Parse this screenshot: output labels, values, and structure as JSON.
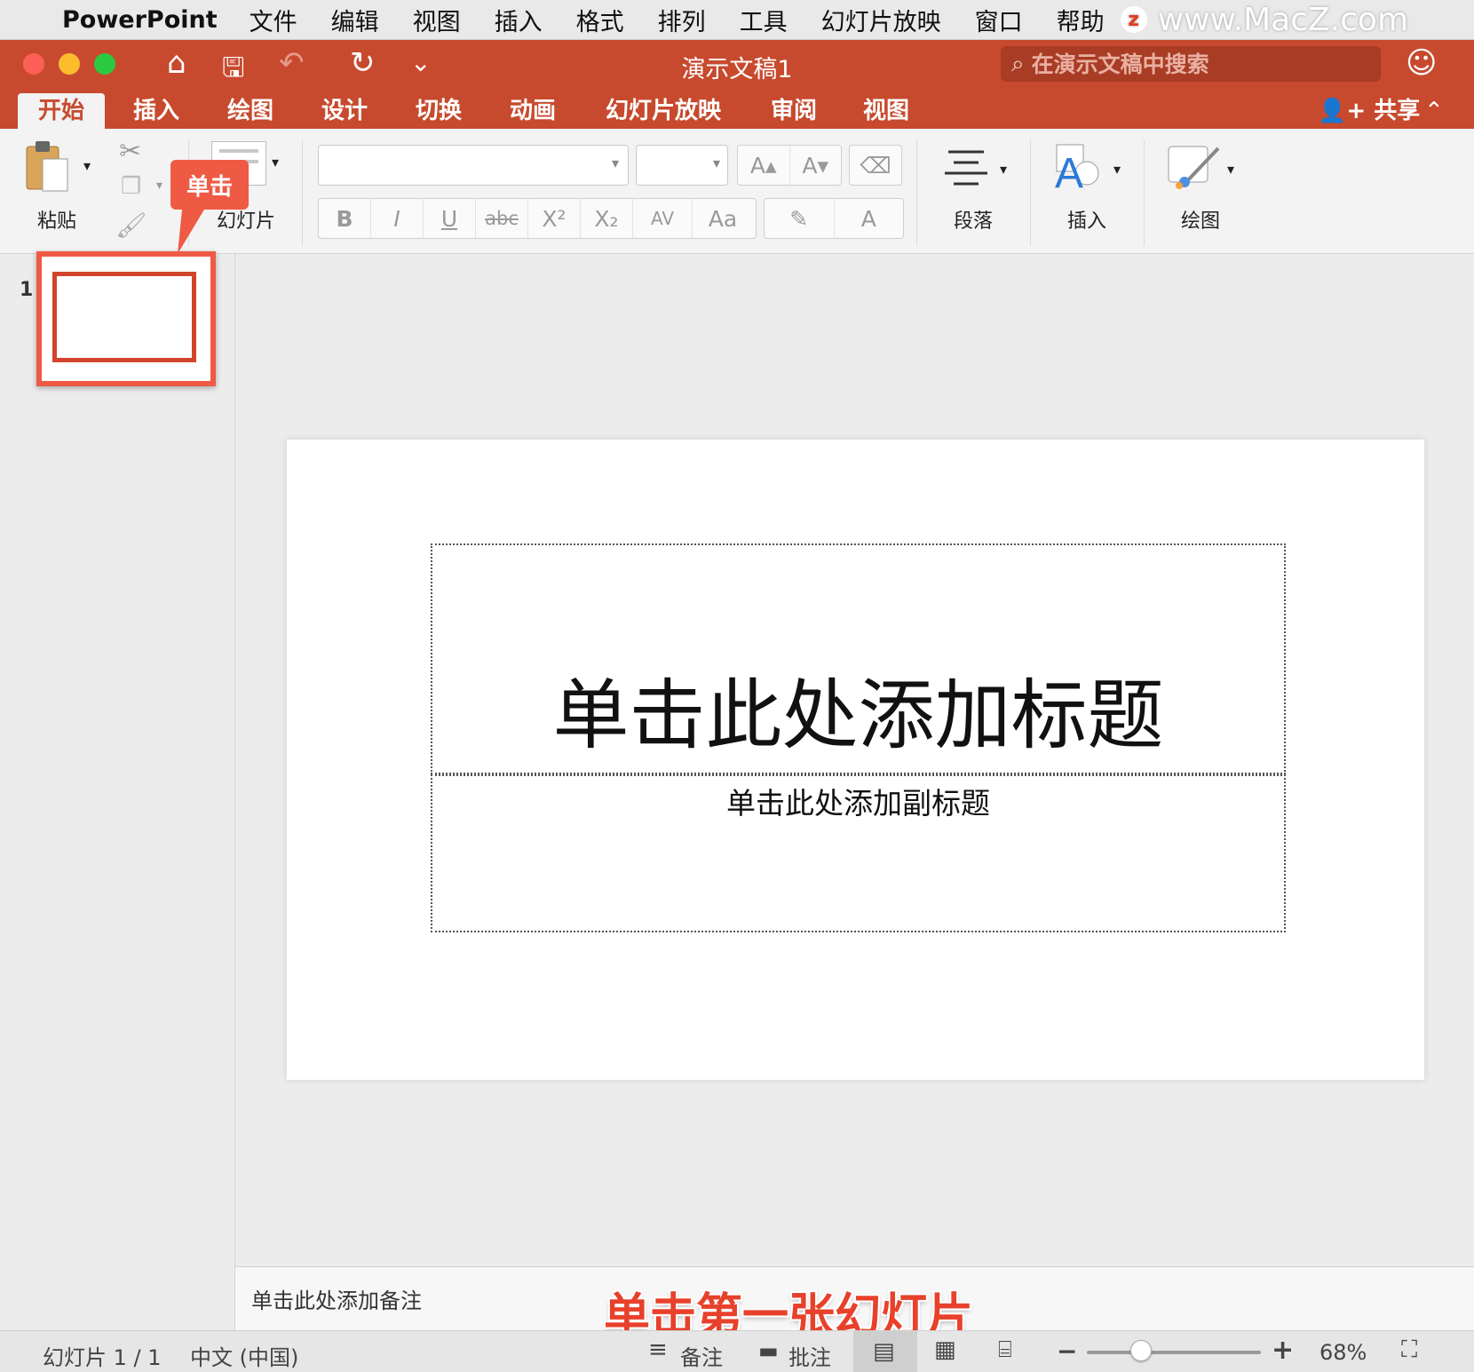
{
  "menubar": {
    "apple": "",
    "app_name": "PowerPoint",
    "items": [
      "文件",
      "编辑",
      "视图",
      "插入",
      "格式",
      "排列",
      "工具",
      "幻灯片放映",
      "窗口",
      "帮助"
    ],
    "watermark": "www.MacZ.com",
    "watermark_logo": "z"
  },
  "titlebar": {
    "document_title": "演示文稿1",
    "search_placeholder": "在演示文稿中搜索",
    "home_icon": "⌂",
    "save_icon": "🖫",
    "undo_icon": "↶",
    "redo_icon": "↻",
    "customize_icon": "⌄",
    "smiley_icon": "☺"
  },
  "tabs": {
    "items": [
      "开始",
      "插入",
      "绘图",
      "设计",
      "切换",
      "动画",
      "幻灯片放映",
      "审阅",
      "视图"
    ],
    "active": "开始",
    "share_label": "共享"
  },
  "ribbon": {
    "paste_label": "粘贴",
    "slide_label": "幻灯片",
    "paragraph_label": "段落",
    "insert_label": "插入",
    "draw_label": "绘图",
    "font_name_value": "",
    "font_size_value": "",
    "format_buttons": [
      "B",
      "I",
      "U",
      "abc",
      "X²",
      "X₂",
      "AV",
      "Aa"
    ],
    "grow_font": "A▴",
    "shrink_font": "A▾",
    "font_color": "A"
  },
  "thumbnails": {
    "slide_number": "1"
  },
  "callout": {
    "text": "单击"
  },
  "slide": {
    "title_placeholder": "单击此处添加标题",
    "subtitle_placeholder": "单击此处添加副标题"
  },
  "notes": {
    "placeholder": "单击此处添加备注"
  },
  "caption": "单击第一张幻灯片",
  "statusbar": {
    "slide_info": "幻灯片 1 / 1",
    "language": "中文 (中国)",
    "notes_label": "备注",
    "comments_label": "批注",
    "zoom_out": "−",
    "zoom_in": "+",
    "zoom_level": "68%",
    "zoom_fraction": 0.31
  },
  "colors": {
    "accent": "#c74a2e",
    "highlight": "#ef5a45"
  }
}
